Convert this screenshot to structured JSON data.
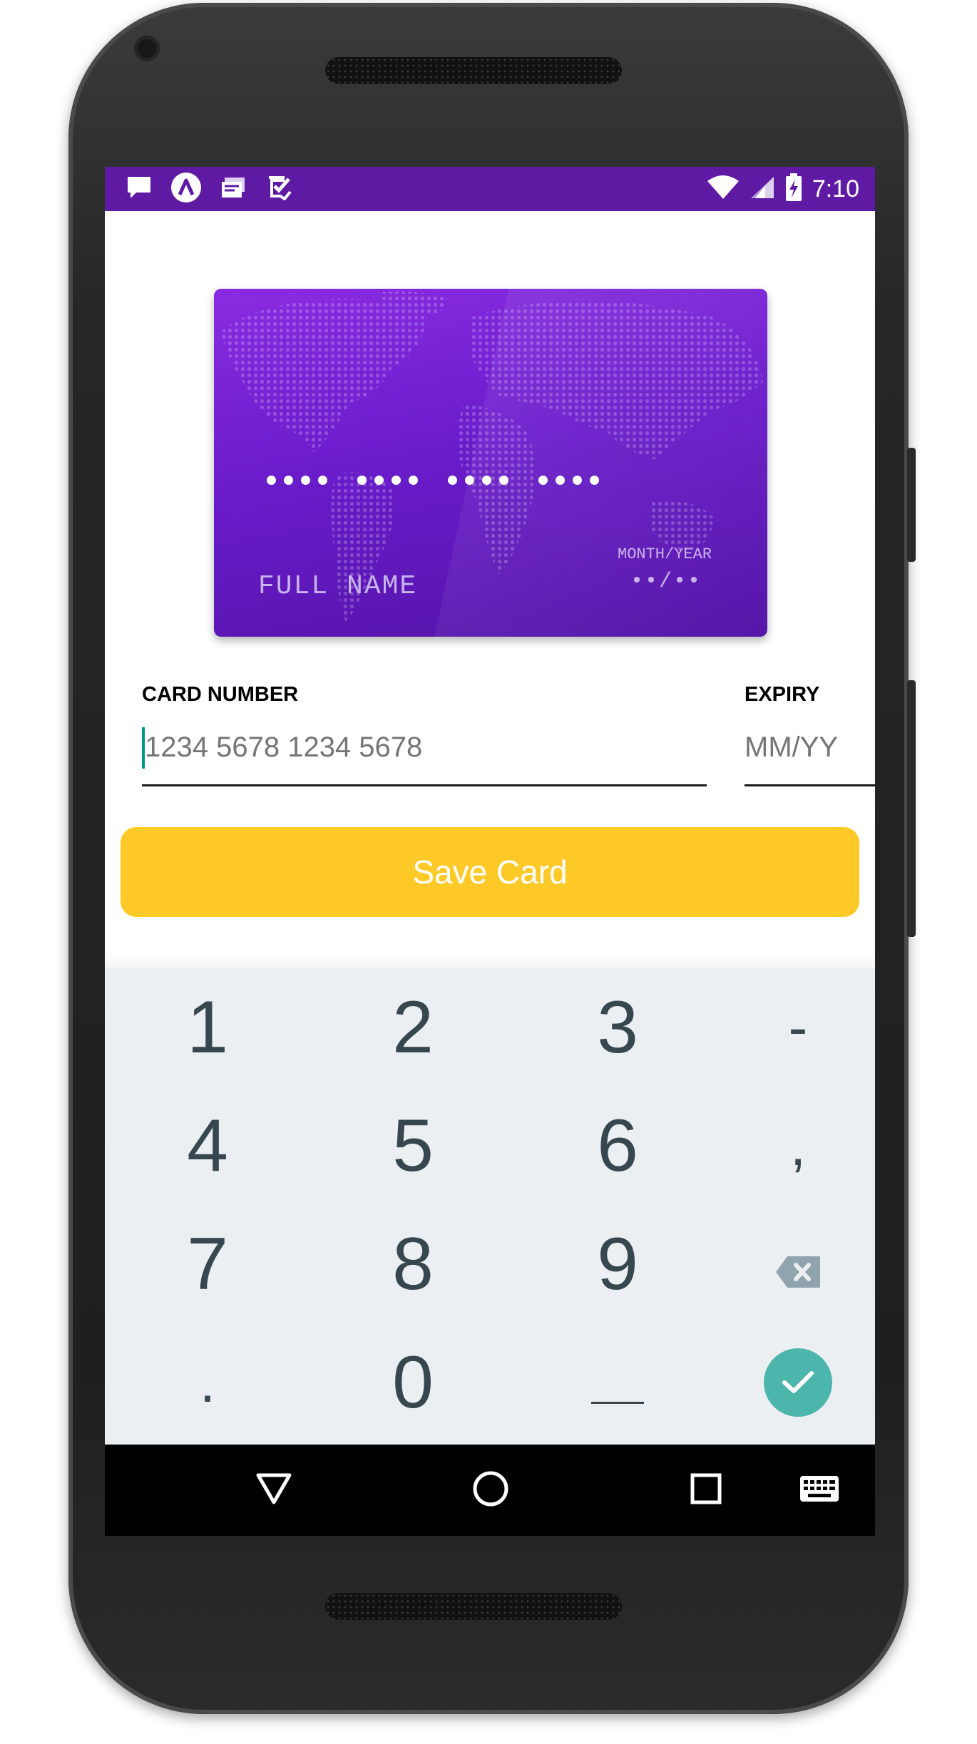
{
  "status_bar": {
    "time": "7:10",
    "left_icons": [
      "message-icon",
      "app-a-icon",
      "inbox-icon",
      "task-check-icon"
    ],
    "right_icons": [
      "wifi-icon",
      "cell-signal-icon",
      "battery-charging-icon"
    ],
    "background": "#5e1aa3"
  },
  "card_preview": {
    "number_placeholder": "•••• •••• •••• ••••",
    "name_placeholder": "FULL NAME",
    "expiry_label": "MONTH/YEAR",
    "expiry_placeholder": "••/••",
    "colors": {
      "top": "#8a2be2",
      "bottom": "#5313a6"
    }
  },
  "form": {
    "card_number_label": "CARD NUMBER",
    "card_number_placeholder": "1234 5678 1234 5678",
    "card_number_value": "",
    "expiry_label": "EXPIRY",
    "expiry_placeholder": "MM/YY",
    "expiry_value": ""
  },
  "save_button": {
    "label": "Save Card",
    "color": "#ffc928"
  },
  "keyboard": {
    "rows": [
      [
        "1",
        "2",
        "3",
        "-"
      ],
      [
        "4",
        "5",
        "6",
        ","
      ],
      [
        "7",
        "8",
        "9",
        "⌫"
      ],
      [
        ".",
        "0",
        "_",
        "✓"
      ]
    ],
    "accent": "#4db6ac"
  },
  "nav_bar": {
    "buttons": [
      "back-icon",
      "home-icon",
      "recents-icon",
      "keyboard-switch-icon"
    ]
  }
}
